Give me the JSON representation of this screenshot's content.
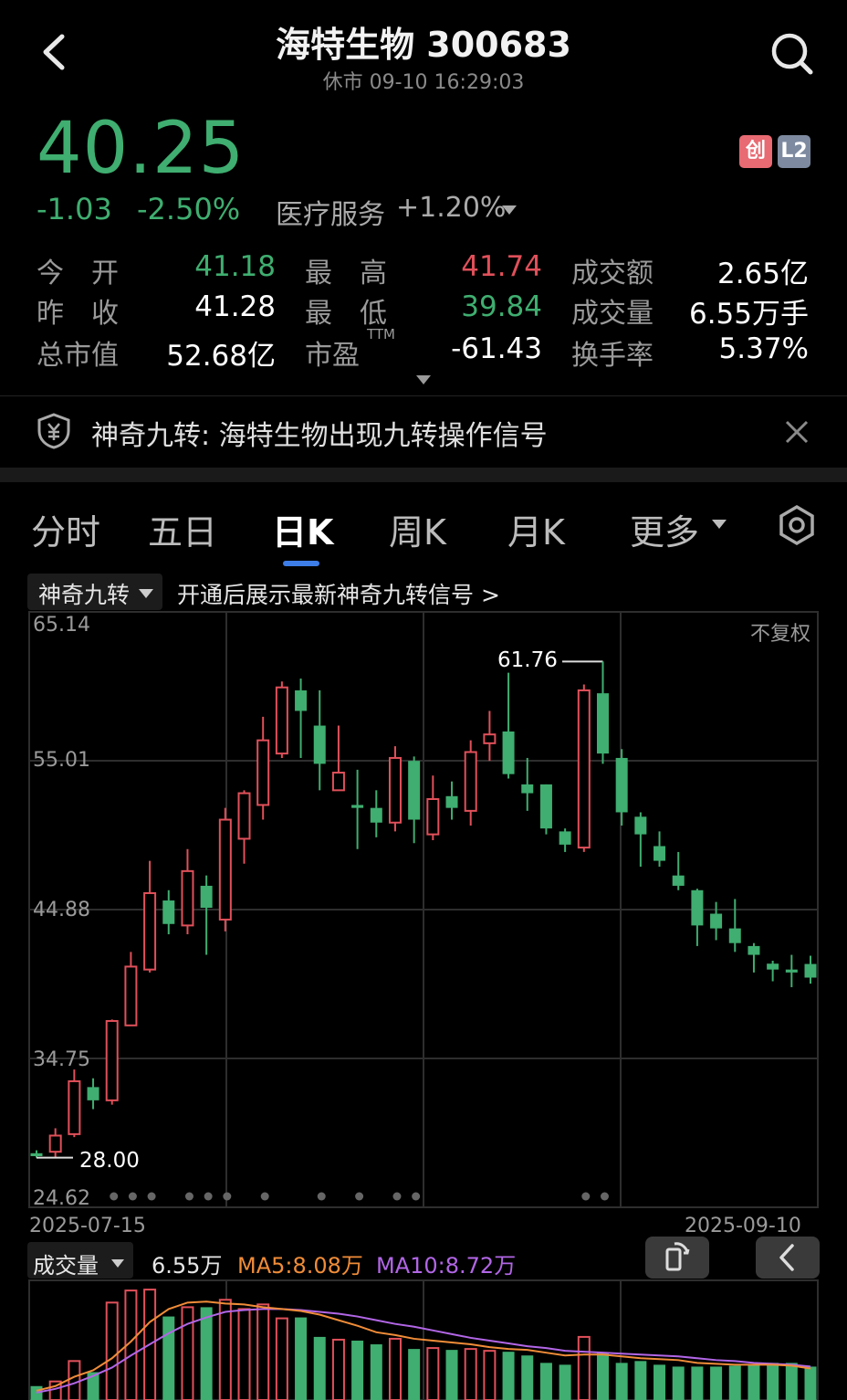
{
  "header": {
    "title": "海特生物 300683",
    "status": "休市 09-10 16:29:03"
  },
  "quote": {
    "price": "40.25",
    "change": "-1.03",
    "change_pct": "-2.50%",
    "industry": "医疗服务",
    "industry_pct": "+1.20%",
    "badge1": "创",
    "badge2": "L2"
  },
  "stats": [
    {
      "label": "今　开",
      "value": "41.18",
      "color": "#3fae70"
    },
    {
      "label": "最　高",
      "value": "41.74",
      "color": "#e0505a"
    },
    {
      "label": "成交额",
      "value": "2.65亿",
      "color": "#ffffff"
    },
    {
      "label": "昨　收",
      "value": "41.28",
      "color": "#ffffff"
    },
    {
      "label": "最　低",
      "value": "39.84",
      "color": "#3fae70"
    },
    {
      "label": "成交量",
      "value": "6.55万手",
      "color": "#ffffff"
    },
    {
      "label": "总市值",
      "value": "52.68亿",
      "color": "#ffffff"
    },
    {
      "label": "市盈",
      "value": "-61.43",
      "color": "#ffffff"
    },
    {
      "label": "换手率",
      "value": "5.37%",
      "color": "#ffffff"
    }
  ],
  "pe_sup": "TTM",
  "signal": {
    "text": "神奇九转: 海特生物出现九转操作信号"
  },
  "tabs": [
    "分时",
    "五日",
    "日K",
    "周K",
    "月K",
    "更多"
  ],
  "selector": {
    "label": "神奇九转",
    "hint": "开通后展示最新神奇九转信号 >"
  },
  "chart_data": {
    "type": "candlestick",
    "y_ticks": [
      "65.14",
      "55.01",
      "44.88",
      "34.75",
      "24.62"
    ],
    "ylim": [
      24.62,
      65.14
    ],
    "adjust": "不复权",
    "x_start": "2025-07-15",
    "x_end": "2025-09-10",
    "max_label": "61.76",
    "min_label": "28.00",
    "candles": [
      {
        "o": 28.3,
        "c": 28.1,
        "h": 28.5,
        "l": 28.0
      },
      {
        "o": 28.4,
        "c": 29.5,
        "h": 30.0,
        "l": 28.0
      },
      {
        "o": 29.6,
        "c": 33.2,
        "h": 34.0,
        "l": 29.4
      },
      {
        "o": 32.8,
        "c": 31.9,
        "h": 33.4,
        "l": 31.3
      },
      {
        "o": 31.9,
        "c": 37.3,
        "h": 37.4,
        "l": 31.6
      },
      {
        "o": 37.0,
        "c": 41.0,
        "h": 42.0,
        "l": 37.0
      },
      {
        "o": 40.8,
        "c": 46.0,
        "h": 48.2,
        "l": 40.6
      },
      {
        "o": 45.5,
        "c": 43.9,
        "h": 46.2,
        "l": 43.2
      },
      {
        "o": 43.8,
        "c": 47.5,
        "h": 49.0,
        "l": 43.2
      },
      {
        "o": 46.5,
        "c": 45.0,
        "h": 47.2,
        "l": 41.8
      },
      {
        "o": 44.2,
        "c": 51.0,
        "h": 51.8,
        "l": 43.4
      },
      {
        "o": 49.7,
        "c": 52.8,
        "h": 53.0,
        "l": 48.0
      },
      {
        "o": 52.0,
        "c": 56.4,
        "h": 58.0,
        "l": 51.0
      },
      {
        "o": 55.5,
        "c": 60.0,
        "h": 60.4,
        "l": 55.2
      },
      {
        "o": 59.8,
        "c": 58.4,
        "h": 60.6,
        "l": 55.2
      },
      {
        "o": 57.4,
        "c": 54.8,
        "h": 59.8,
        "l": 53.0
      },
      {
        "o": 53.0,
        "c": 54.2,
        "h": 57.4,
        "l": 53.0
      },
      {
        "o": 52.0,
        "c": 51.8,
        "h": 54.4,
        "l": 49.0
      },
      {
        "o": 51.8,
        "c": 50.8,
        "h": 53.0,
        "l": 49.8
      },
      {
        "o": 50.8,
        "c": 55.2,
        "h": 56.0,
        "l": 50.2
      },
      {
        "o": 55.0,
        "c": 51.0,
        "h": 55.3,
        "l": 49.4
      },
      {
        "o": 50.0,
        "c": 52.4,
        "h": 54.0,
        "l": 49.6
      },
      {
        "o": 52.6,
        "c": 51.8,
        "h": 53.6,
        "l": 51.0
      },
      {
        "o": 51.6,
        "c": 55.6,
        "h": 56.4,
        "l": 50.6
      },
      {
        "o": 56.2,
        "c": 56.8,
        "h": 58.4,
        "l": 55.0
      },
      {
        "o": 57.0,
        "c": 54.1,
        "h": 61.0,
        "l": 53.8
      },
      {
        "o": 53.4,
        "c": 52.8,
        "h": 55.2,
        "l": 51.6
      },
      {
        "o": 53.4,
        "c": 50.4,
        "h": 53.4,
        "l": 50.0
      },
      {
        "o": 50.2,
        "c": 49.3,
        "h": 50.4,
        "l": 48.8
      },
      {
        "o": 49.1,
        "c": 59.8,
        "h": 60.2,
        "l": 48.8
      },
      {
        "o": 59.6,
        "c": 55.5,
        "h": 61.76,
        "l": 54.8
      },
      {
        "o": 55.2,
        "c": 51.5,
        "h": 55.8,
        "l": 50.6
      },
      {
        "o": 51.2,
        "c": 50.0,
        "h": 51.5,
        "l": 47.8
      },
      {
        "o": 49.2,
        "c": 48.2,
        "h": 50.2,
        "l": 47.8
      },
      {
        "o": 47.2,
        "c": 46.5,
        "h": 48.8,
        "l": 46.2
      },
      {
        "o": 46.2,
        "c": 43.8,
        "h": 46.3,
        "l": 42.4
      },
      {
        "o": 44.6,
        "c": 43.6,
        "h": 45.4,
        "l": 42.8
      },
      {
        "o": 43.6,
        "c": 42.6,
        "h": 45.6,
        "l": 42.0
      },
      {
        "o": 42.4,
        "c": 41.8,
        "h": 42.6,
        "l": 40.6
      },
      {
        "o": 41.2,
        "c": 40.8,
        "h": 41.4,
        "l": 40.0
      },
      {
        "o": 40.8,
        "c": 40.6,
        "h": 41.8,
        "l": 39.6
      },
      {
        "o": 41.18,
        "c": 40.25,
        "h": 41.74,
        "l": 39.84
      }
    ]
  },
  "volume": {
    "label": "成交量",
    "value": "6.55万",
    "ma5": "MA5:8.08万",
    "ma10": "MA10:8.72万",
    "ma5_color": "#f08c38",
    "ma10_color": "#b266e6",
    "bars": [
      1.5,
      2.0,
      4.2,
      3.0,
      10.5,
      11.8,
      11.9,
      9.0,
      10.0,
      10.0,
      10.8,
      9.8,
      10.3,
      8.8,
      8.9,
      6.8,
      6.5,
      6.4,
      6.0,
      6.6,
      5.5,
      5.6,
      5.4,
      5.5,
      5.3,
      5.2,
      4.8,
      4.0,
      3.8,
      6.8,
      5.1,
      4.0,
      4.2,
      3.8,
      3.6,
      3.6,
      3.6,
      3.7,
      3.8,
      4.0,
      4.0,
      3.6
    ],
    "ma5_line": [
      1.0,
      1.5,
      2.5,
      3.2,
      4.5,
      6.3,
      8.4,
      9.8,
      10.5,
      10.6,
      10.4,
      10.3,
      10.0,
      9.8,
      9.6,
      9.2,
      8.6,
      8.0,
      7.3,
      7.0,
      6.6,
      6.4,
      6.2,
      6.0,
      5.7,
      5.5,
      5.4,
      5.1,
      4.8,
      4.9,
      4.9,
      4.7,
      4.5,
      4.4,
      4.3,
      4.0,
      3.9,
      3.8,
      3.8,
      3.8,
      3.7,
      3.4
    ],
    "ma10_line": [
      0.8,
      1.2,
      1.8,
      2.6,
      3.5,
      4.8,
      6.0,
      7.2,
      8.2,
      8.9,
      9.5,
      9.7,
      9.8,
      9.8,
      9.7,
      9.5,
      9.3,
      9.0,
      8.6,
      8.2,
      7.9,
      7.5,
      7.1,
      6.7,
      6.4,
      6.1,
      5.8,
      5.6,
      5.3,
      5.2,
      5.1,
      5.0,
      4.9,
      4.8,
      4.7,
      4.5,
      4.3,
      4.2,
      4.0,
      3.9,
      3.8,
      3.6
    ]
  }
}
